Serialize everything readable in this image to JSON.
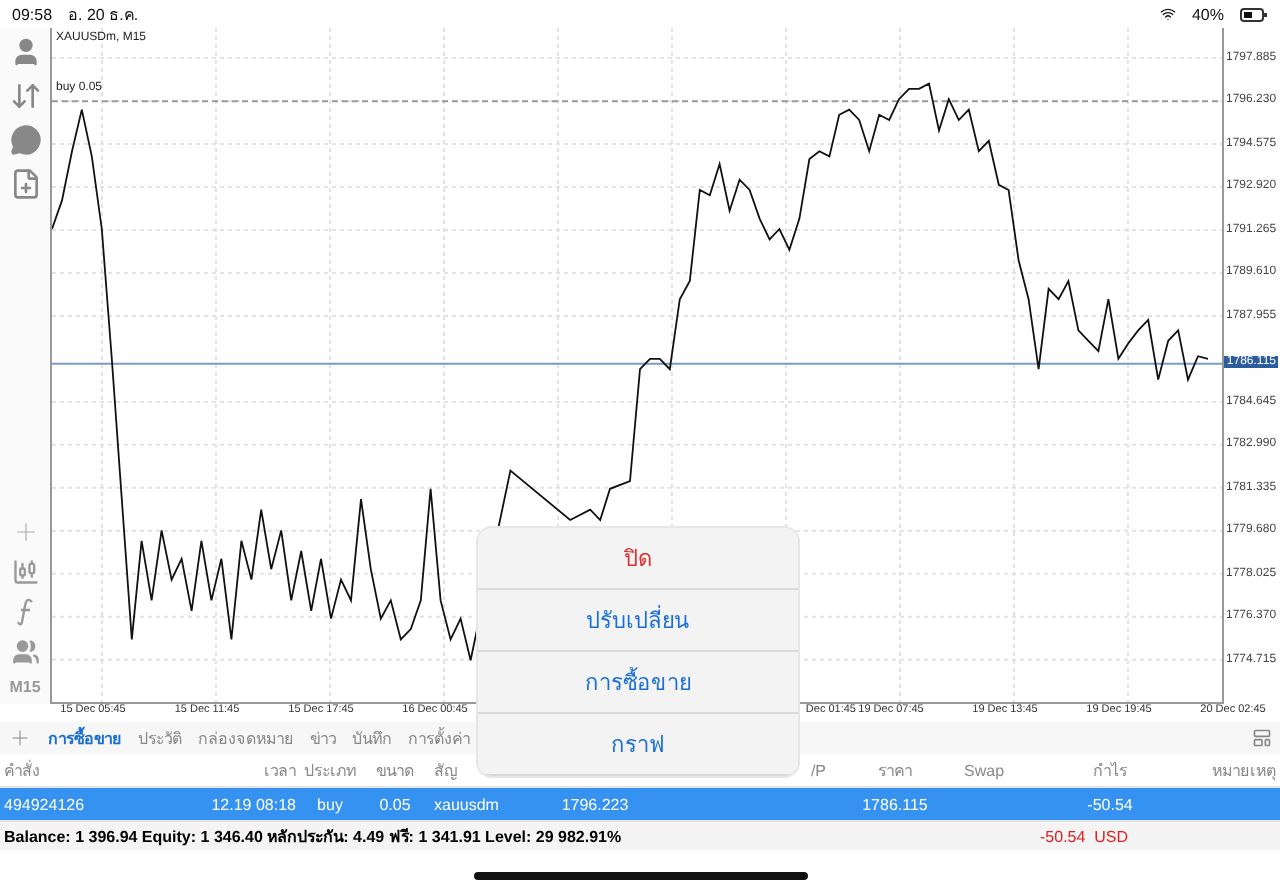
{
  "status_bar": {
    "time": "09:58",
    "date": "อ. 20 ธ.ค.",
    "battery": "40%"
  },
  "toolbar": {
    "timeframe": "M15"
  },
  "chart": {
    "symbol": "XAUUSDm, M15",
    "chart_data": {
      "type": "line",
      "grid": true,
      "ylim": [
        1773.09,
        1799.04
      ],
      "ref_lines": [
        {
          "axis": "y",
          "value": 1796.223,
          "label": "buy 0.05",
          "color": "#999999"
        },
        {
          "axis": "y",
          "value": 1786.115,
          "label": "1786.115",
          "color": "#7a9cc6"
        }
      ],
      "yticks": [
        {
          "value": 1797.885,
          "label": "1797.885"
        },
        {
          "value": 1796.23,
          "label": "1796.230"
        },
        {
          "value": 1794.575,
          "label": "1794.575"
        },
        {
          "value": 1792.92,
          "label": "1792.920"
        },
        {
          "value": 1791.265,
          "label": "1791.265"
        },
        {
          "value": 1789.61,
          "label": "1789.610"
        },
        {
          "value": 1787.955,
          "label": "1787.955"
        },
        {
          "value": 1784.645,
          "label": "1784.645"
        },
        {
          "value": 1782.99,
          "label": "1782.990"
        },
        {
          "value": 1781.335,
          "label": "1781.335"
        },
        {
          "value": 1779.68,
          "label": "1779.680"
        },
        {
          "value": 1778.025,
          "label": "1778.025"
        },
        {
          "value": 1776.37,
          "label": "1776.370"
        },
        {
          "value": 1774.715,
          "label": "1774.715"
        }
      ],
      "series": [
        {
          "color": "#111111",
          "values": [
            1791.3,
            1792.4,
            1794.3,
            1795.9,
            1794.1,
            1791.3,
            1786.3,
            1780.9,
            1775.5,
            1779.3,
            1777.0,
            1779.7,
            1777.8,
            1778.6,
            1776.6,
            1779.3,
            1777.0,
            1778.6,
            1775.5,
            1779.3,
            1777.8,
            1780.5,
            1778.2,
            1779.7,
            1777.0,
            1778.9,
            1776.6,
            1778.6,
            1776.3,
            1777.8,
            1777.0,
            1780.9,
            1778.2,
            1776.3,
            1777.0,
            1775.5,
            1775.9,
            1777.0,
            1781.3,
            1777.0,
            1775.5,
            1776.3,
            1774.7,
            null,
            null,
            null,
            1782.0,
            null,
            null,
            null,
            null,
            null,
            1780.1,
            null,
            1780.5,
            1780.1,
            1781.3,
            null,
            1781.6,
            1785.9,
            1786.3,
            1786.3,
            1785.9,
            1788.6,
            1789.3,
            1792.8,
            1792.6,
            1793.8,
            1792.0,
            1793.2,
            1792.8,
            1791.7,
            1790.9,
            1791.3,
            1790.5,
            1791.7,
            1794.0,
            1794.3,
            1794.1,
            1795.7,
            1795.9,
            1795.5,
            1794.3,
            1795.7,
            1795.5,
            1796.3,
            1796.7,
            1796.7,
            1796.9,
            1795.1,
            1796.3,
            1795.5,
            1795.9,
            1794.3,
            1794.7,
            1793.0,
            1792.8,
            1790.1,
            1788.6,
            1785.9,
            1789.0,
            1788.6,
            1789.3,
            1787.4,
            1787.0,
            1786.6,
            1788.6,
            1786.3,
            1786.9,
            1787.4,
            1787.8,
            1785.5,
            1787.0,
            1787.4,
            1785.5,
            1786.4,
            1786.3
          ]
        }
      ]
    },
    "time_labels": [
      "15 Dec 05:45",
      "15 Dec 11:45",
      "15 Dec 17:45",
      "16 Dec 00:45",
      "Dec 01:45",
      "19 Dec 07:45",
      "19 Dec 13:45",
      "19 Dec 19:45",
      "20 Dec 02:45"
    ]
  },
  "tabs": [
    {
      "label": "การซื้อขาย",
      "selected": true
    },
    {
      "label": "ประวัติ",
      "selected": false
    },
    {
      "label": "กล่องจดหมาย",
      "selected": false
    },
    {
      "label": "ข่าว",
      "selected": false
    },
    {
      "label": "บันทึก",
      "selected": false
    },
    {
      "label": "การตั้งค่า",
      "selected": false
    }
  ],
  "table": {
    "columns": {
      "order": "คำสั่ง",
      "time": "เวลา",
      "type": "ประเภท",
      "size": "ขนาด",
      "symbol": "สัญ",
      "tp": "/P",
      "price": "ราคา",
      "swap": "Swap",
      "profit": "กำไร",
      "comment": "หมายเหตุ"
    },
    "rows": [
      {
        "selected": true,
        "order": "494924126",
        "time": "12.19 08:18",
        "type": "buy",
        "size": "0.05",
        "symbol": "xauusdm",
        "open_price": "1796.223",
        "price": "1786.115",
        "profit": "-50.54"
      }
    ],
    "summary": {
      "text": "Balance: 1 396.94 Equity: 1 346.40 หลักประกัน: 4.49 ฟรี: 1 341.91 Level: 29 982.91%",
      "profit": "-50.54",
      "currency": "USD"
    }
  },
  "action_sheet": {
    "items": [
      {
        "label": "ปิด",
        "kind": "destructive"
      },
      {
        "label": "ปรับเปลี่ยน",
        "kind": "default"
      },
      {
        "label": "การซื้อขาย",
        "kind": "default"
      },
      {
        "label": "กราฟ",
        "kind": "default"
      }
    ]
  }
}
